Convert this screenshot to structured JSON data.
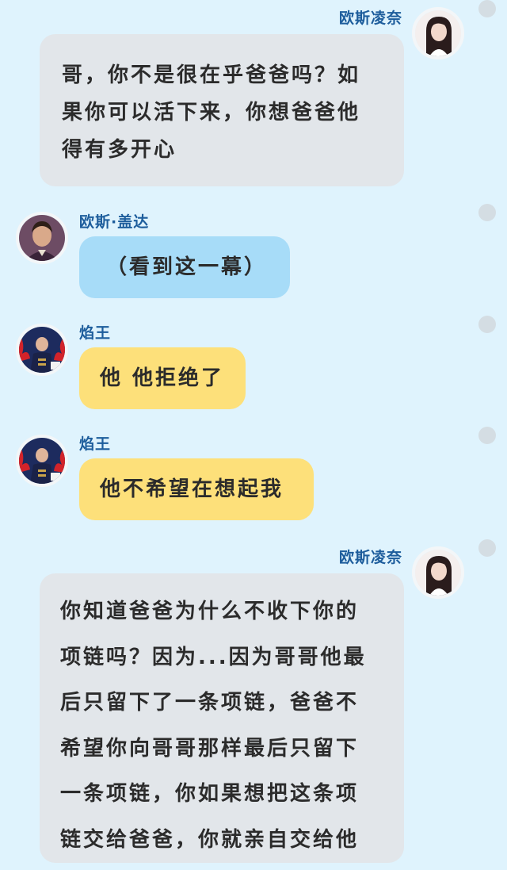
{
  "messages": [
    {
      "sender": "欧斯凌奈",
      "avatar": "girl-avatar-icon",
      "lines": [
        "哥，你不是很在乎爸爸吗？如",
        "果你可以活下来，你想爸爸他",
        "得有多开心"
      ]
    },
    {
      "sender": "欧斯·盖达",
      "avatar": "man-avatar-icon",
      "lines": [
        "（看到这一幕）"
      ]
    },
    {
      "sender": "焰王",
      "avatar": "flame-king-avatar-icon",
      "lines": [
        "他 他拒绝了"
      ]
    },
    {
      "sender": "焰王",
      "avatar": "flame-king-avatar-icon",
      "lines": [
        "他不希望在想起我"
      ]
    },
    {
      "sender": "欧斯凌奈",
      "avatar": "girl-avatar-icon",
      "lines": [
        "你知道爸爸为什么不收下你的",
        "项链吗？因为...因为哥哥他最",
        "后只留下了一条项链，爸爸不",
        "希望你向哥哥那样最后只留下",
        "一条项链，你如果想把这条项",
        "链交给爸爸，你就亲自交给他"
      ]
    }
  ],
  "colors": {
    "background": "#dff3fd",
    "name": "#1d5d9c",
    "bubble_gray": "#e2e6ea",
    "bubble_blue": "#a7dcf8",
    "bubble_yellow": "#fde07a"
  }
}
